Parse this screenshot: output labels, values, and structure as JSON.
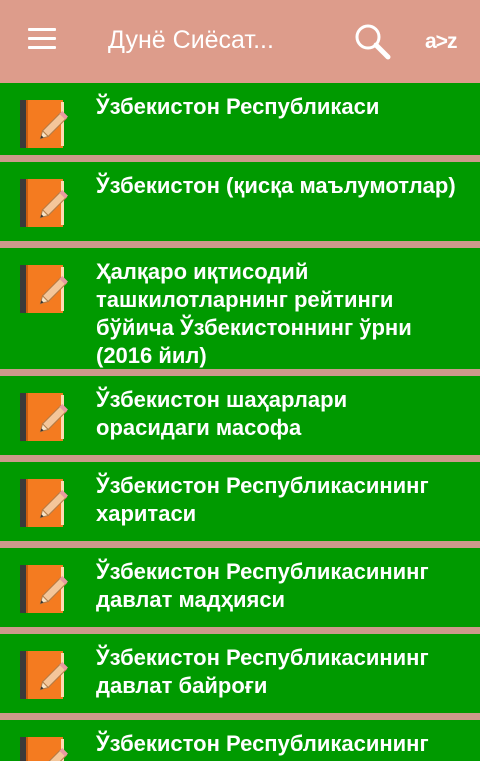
{
  "appbar": {
    "title": "Дунё Сиёсат...",
    "az_label": "a>z",
    "menu_icon": "hamburger-menu-icon",
    "search_icon": "search-icon"
  },
  "colors": {
    "appbar": "#dd9c8b",
    "item_bg": "#009a00",
    "separator": "#cc9a8b",
    "book_orange": "#f47b20"
  },
  "items": [
    {
      "label": "Ўзбекистон Республикаси"
    },
    {
      "label": "Ўзбекистон (қисқа маълумотлар)"
    },
    {
      "label": "Ҳалқаро иқтисодий ташкилотларнинг рейтинги бўйича Ўзбекистоннинг ўрни (2016 йил)"
    },
    {
      "label": "Ўзбекистон шаҳарлари орасидаги масофа"
    },
    {
      "label": "Ўзбекистон Республикасининг харитаси"
    },
    {
      "label": "Ўзбекистон Республикасининг давлат мадҳияси"
    },
    {
      "label": "Ўзбекистон Республикасининг давлат байроғи"
    },
    {
      "label": "Ўзбекистон Республикасининг"
    }
  ]
}
